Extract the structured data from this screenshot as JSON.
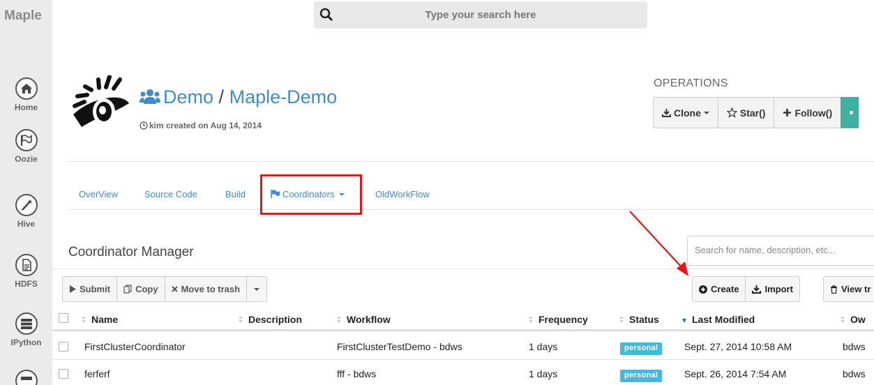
{
  "sidebar": {
    "brand": "Maple",
    "items": [
      {
        "label": "Home",
        "icon": "home-icon"
      },
      {
        "label": "Oozie",
        "icon": "oozie-flag-icon"
      },
      {
        "label": "Hive",
        "icon": "hive-wand-icon"
      },
      {
        "label": "HDFS",
        "icon": "hdfs-file-icon"
      },
      {
        "label": "IPython",
        "icon": "ipython-server-icon"
      }
    ]
  },
  "search": {
    "placeholder": "Type your search here"
  },
  "project": {
    "owner": "Demo",
    "separator": "/",
    "name": "Maple-Demo",
    "meta": "kim created on Aug 14, 2014"
  },
  "operations": {
    "title": "OPERATIONS",
    "clone": "Clone",
    "star": "Star()",
    "follow": "Follow()"
  },
  "tabs": [
    {
      "label": "OverView"
    },
    {
      "label": "Source Code"
    },
    {
      "label": "Build"
    },
    {
      "label": "Coordinators"
    },
    {
      "label": "OldWorkFlow"
    }
  ],
  "manager": {
    "title": "Coordinator Manager",
    "filter_placeholder": "Search for name, description, etc...",
    "actions": {
      "submit": "Submit",
      "copy": "Copy",
      "trash": "Move to trash",
      "create": "Create",
      "import": "Import",
      "view_trash": "View tr"
    }
  },
  "table": {
    "headers": {
      "name": "Name",
      "description": "Description",
      "workflow": "Workflow",
      "frequency": "Frequency",
      "status": "Status",
      "last_modified": "Last Modified",
      "owner": "Ow"
    },
    "rows": [
      {
        "name": "FirstClusterCoordinator",
        "description": "",
        "workflow": "FirstClusterTestDemo - bdws",
        "frequency": "1 days",
        "status": "personal",
        "last_modified": "Sept. 27, 2014 10:58 AM",
        "owner": "bdws"
      },
      {
        "name": "ferferf",
        "description": "",
        "workflow": "fff - bdws",
        "frequency": "1 days",
        "status": "personal",
        "last_modified": "Sept. 26, 2014 7:54 AM",
        "owner": "bdws"
      }
    ]
  },
  "colors": {
    "link": "#428bca",
    "highlight": "#e8141b",
    "badge": "#46b8da",
    "teal_button": "#3fb1a0"
  }
}
